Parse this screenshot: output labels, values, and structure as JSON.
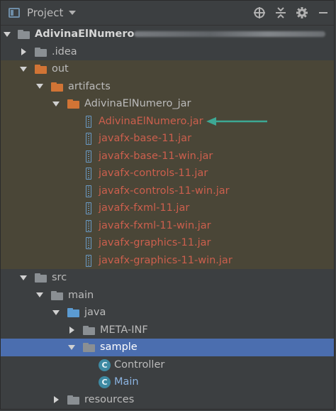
{
  "header": {
    "title": "Project",
    "tools": [
      "crosshair-icon",
      "collapse-icon",
      "gear-icon",
      "minimize-icon"
    ]
  },
  "tree": {
    "root": {
      "label": "AdivinaElNumero"
    },
    "idea": {
      "label": ".idea"
    },
    "out": {
      "label": "out"
    },
    "artifacts": {
      "label": "artifacts"
    },
    "artifact_folder": {
      "label": "AdivinaElNumero_jar"
    },
    "jars": [
      "AdivinaElNumero.jar",
      "javafx-base-11.jar",
      "javafx-base-11-win.jar",
      "javafx-controls-11.jar",
      "javafx-controls-11-win.jar",
      "javafx-fxml-11.jar",
      "javafx-fxml-11-win.jar",
      "javafx-graphics-11.jar",
      "javafx-graphics-11-win.jar"
    ],
    "src": {
      "label": "src"
    },
    "main": {
      "label": "main"
    },
    "java": {
      "label": "java"
    },
    "meta_inf": {
      "label": "META-INF"
    },
    "sample": {
      "label": "sample"
    },
    "controller": {
      "label": "Controller",
      "icon_letter": "C"
    },
    "main_class": {
      "label": "Main",
      "icon_letter": "C"
    },
    "resources": {
      "label": "resources"
    }
  },
  "colors": {
    "background": "#3c3f41",
    "excluded_background": "#4a4637",
    "selection": "#4b6eaf",
    "excluded_text": "#cc5f4d",
    "default_text": "#bbbbbb",
    "link_text": "#8bb3e0",
    "annotation_arrow": "#3da894"
  }
}
